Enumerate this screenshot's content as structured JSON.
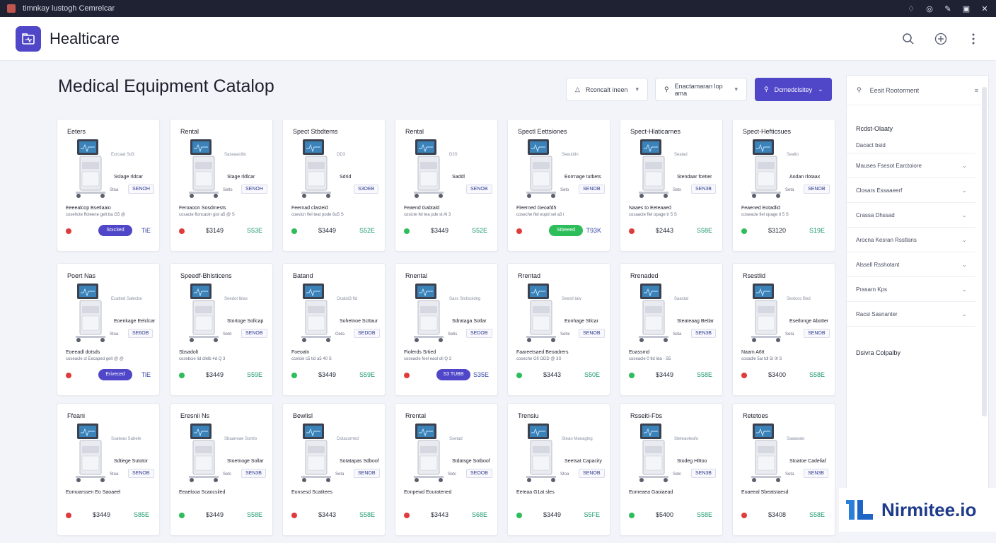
{
  "window": {
    "title": "timnkay lustogh Cemrelcar"
  },
  "header": {
    "brand": "Healticare"
  },
  "page": {
    "title": "Medical Equipment Catalop"
  },
  "filters": [
    {
      "label": "Rconcalt ineen"
    },
    {
      "label": "Enactamaran lop ama"
    },
    {
      "label": "Dcmedclsitey"
    }
  ],
  "colors": {
    "accent": "#4f46c8",
    "status_red": "#e03b3b",
    "status_green": "#2dbd5a",
    "price_green": "#1f9a6d"
  },
  "cards": [
    {
      "title": "Eeters",
      "note1": "Ecrcaat Sd3",
      "spec": "Sslage rldcar",
      "cell": "Stoa",
      "tag": "SENOH",
      "name": "Eeeealcop Bsetlaaio",
      "meta": "cosehcte ffoleene gelt ba G5 @",
      "status": "red",
      "button": "Stxc3ed",
      "price2": "TiE"
    },
    {
      "title": "Rental",
      "note1": "Saseaactllo",
      "spec": "Stage rldlcar",
      "cell": "Setts",
      "tag": "SENOH",
      "name": "Feroaoon Sosdmests",
      "meta": "cosacte floncaoin gisl a5 @ S",
      "status": "red",
      "price": "$3149",
      "price2": "S53E"
    },
    {
      "title": "Spect Stbdtems",
      "note1": "DD3",
      "spec": "Sdrid",
      "cell": "",
      "tag": "S3OEB",
      "name": "Feernad clasteid",
      "meta": "coesicn fiel teat pode 8u5 S",
      "status": "green",
      "price": "$3449",
      "price2": "S52E"
    },
    {
      "title": "Rental",
      "note1": "D3S",
      "spec": "Saddl",
      "cell": "",
      "tag": "SENOB",
      "name": "Feaend Gabtald",
      "meta": "cosicte fel tea pde st Al 3",
      "status": "green",
      "price": "$3449",
      "price2": "S52E"
    },
    {
      "title": "Spectl Eettsiones",
      "note1": "Seeutidn",
      "spec": "Eorrnage tutbets",
      "cell": "Seto",
      "tag": "SENOB",
      "name": "Fleerned Geoafd5",
      "meta": "coseche flel eopd sel a3 i",
      "status": "red",
      "button": "Stbeeed",
      "button_color": "green",
      "price2": "T93K"
    },
    {
      "title": "Spect-Hlaticarnes",
      "note1": "Sealad",
      "spec": "Stendaar fcetier",
      "cell": "Sets",
      "tag": "SEN3B",
      "name": "Naaes to Eeteaaed",
      "meta": "cosaacte fiel opage tr 5 S",
      "status": "red",
      "price": "$2443",
      "price2": "S58E"
    },
    {
      "title": "Spect-Hefticsues",
      "note1": "Sealto",
      "spec": "Aodan rlotaax",
      "cell": "Seta",
      "tag": "SENOB",
      "name": "Feaened Eotadlid",
      "meta": "coseacle fiel opage tl 5 S",
      "status": "green",
      "price": "$3120",
      "price2": "S19E"
    },
    {
      "title": "Poert Nas",
      "note1": "Ecatted Salecbe",
      "spec": "Eoenkage Eelclcar",
      "cell": "Stoa",
      "tag": "SE6OB",
      "name": "Eoeeadl dotsds",
      "meta": "coseacle cl Eecaped gelt @ @",
      "status": "red",
      "button": "Eriveced",
      "price2": "TiE"
    },
    {
      "title": "Speedf-Bhlsticens",
      "note1": "Seedot lbias",
      "spec": "Stortoge Sollcap",
      "cell": "Setd",
      "tag": "SENOB",
      "name": "Sbsadolt",
      "meta": "cosebcie lid dlelb 4d Q 3",
      "status": "green",
      "price": "$3449",
      "price2": "S59E"
    },
    {
      "title": "Batand",
      "note1": "Ocabd3 fid",
      "spec": "Sohetnoe Scttaur",
      "cell": "Oeta",
      "tag": "SEDOB",
      "name": "Foeoaln",
      "meta": "ccelcie c5 tid a5 40 S",
      "status": "green",
      "price": "$3449",
      "price2": "S59E"
    },
    {
      "title": "Rnental",
      "note1": "Sass Stctisoidng",
      "spec": "Sdrataga Sotlar",
      "cell": "Setis",
      "tag": "SEDOB",
      "name": "Fiolerds Srtied",
      "meta": "coseacle feel eaol oll Q 3",
      "status": "red",
      "button": "S3 TUBB",
      "price2": "S35E"
    },
    {
      "title": "Rrentad",
      "note1": "Seestl taw",
      "spec": "Eonhage Stlcar",
      "cell": "Selte",
      "tag": "SENOB",
      "name": "Faareetsaed Beoadrers",
      "meta": "coseche Gfi ODD @ 3S",
      "status": "green",
      "price": "$3443",
      "price2": "S50E"
    },
    {
      "title": "Rrenaded",
      "note1": "Saastal",
      "spec": "Steateaag Betlar",
      "cell": "Seta",
      "tag": "SEN3B",
      "name": "Eoassmd",
      "meta": "coseacle 0 tld Ida - S5",
      "status": "green",
      "price": "$3449",
      "price2": "S58E"
    },
    {
      "title": "Rsestlid",
      "note1": "Sestcoc Bed",
      "spec": "Esetlonge Abotter",
      "cell": "Seta",
      "tag": "SENOB",
      "name": "Naam A6tt",
      "meta": "cosadle 5al tdl 5t 0t S",
      "status": "red",
      "price": "$3400",
      "price2": "S58E"
    },
    {
      "title": "Ffeani",
      "note1": "Ssateao Sabele",
      "spec": "Sdtiege Sutotor",
      "cell": "Stoa",
      "tag": "SENOB",
      "name": "Eomoarssen Eo Saoaeel",
      "meta": "",
      "status": "red",
      "price": "$3449",
      "price2": "S85E"
    },
    {
      "title": "Eresnii Ns",
      "note1": "Sbaaneae Sontlo",
      "spec": "Stoetnoge Sollar",
      "cell": "Setc",
      "tag": "SEN3B",
      "name": "Eeaelooa Scaocsiled",
      "meta": "",
      "status": "green",
      "price": "$3449",
      "price2": "S58E"
    },
    {
      "title": "Bewlisl",
      "note1": "Dotacorned",
      "spec": "Sotatapas Sdboof",
      "cell": "Seta",
      "tag": "SENOB",
      "name": "Eonsesd Scatitees",
      "meta": "",
      "status": "red",
      "price": "$3443",
      "price2": "S58E"
    },
    {
      "title": "Rrental",
      "note1": "Ssetad",
      "spec": "Stdatsge Sotboof",
      "cell": "Setc",
      "tag": "SEOOB",
      "name": "Eonpewd Eouratened",
      "meta": "",
      "status": "red",
      "price": "$3443",
      "price2": "S68E"
    },
    {
      "title": "Trensiu",
      "note1": "Steao Managing",
      "spec": "Seetsat Capacity",
      "cell": "Stoa",
      "tag": "SENOB",
      "name": "Eeteaa G1at sles",
      "meta": "",
      "status": "green",
      "price": "$3449",
      "price2": "S5FE"
    },
    {
      "title": "Rsseiti-Fbs",
      "note1": "Steteaoteafo",
      "spec": "Stodeg Hlttoo",
      "cell": "Setc",
      "tag": "SEN3B",
      "name": "Eomeaea Gaoiaead",
      "meta": "",
      "status": "green",
      "price": "$5400",
      "price2": "S58E"
    },
    {
      "title": "Retetoes",
      "note1": "Saaaealo",
      "spec": "Stoatoe Cadeliaf",
      "cell": "Seta",
      "tag": "SEN3B",
      "name": "Eoaeeal Sbeatstaesd",
      "meta": "",
      "status": "red",
      "price": "$3408",
      "price2": "S58E"
    }
  ],
  "sidebar": {
    "search_placeholder": "Eesit Rootorment",
    "heading": "Rcdst-Olaaty",
    "subheading": "Dacact bsid",
    "items": [
      "Mauses Fsesot Earctoiore",
      "Closars Essaaeerf",
      "Crassa Dhssad",
      "Arocna Kesran Rsstlans",
      "Alssell Rsshotant",
      "Prasarn Kps",
      "Racsi Sasnanter"
    ],
    "footer": "Dsivra Colpalby"
  },
  "watermark": {
    "text": "Nirmitee.io"
  }
}
